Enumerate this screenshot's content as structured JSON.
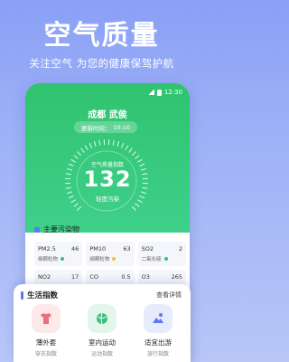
{
  "promo": {
    "title": "空气质量",
    "subtitle": "关注空气 为您的健康保驾护航"
  },
  "status_bar": {
    "time": "12:30"
  },
  "hero": {
    "city": "成都 武侯",
    "update_label": "更新时间：",
    "update_time": "10:10",
    "index_label": "空气质量指数",
    "aqi": "132",
    "level": "轻度污染",
    "colors": {
      "hero": "#2fc36f"
    }
  },
  "pollutants": {
    "title": "主要污染物",
    "items": [
      {
        "name": "PM2.5",
        "value": "46",
        "desc": "细颗粒物",
        "color": "#2fc36f"
      },
      {
        "name": "PM10",
        "value": "63",
        "desc": "细颗粒物",
        "color": "#f2c230"
      },
      {
        "name": "SO2",
        "value": "2",
        "desc": "二氧化硫",
        "color": "#2fc36f"
      },
      {
        "name": "NO2",
        "value": "17",
        "desc": "",
        "color": "#2fc36f"
      },
      {
        "name": "CO",
        "value": "0.5",
        "desc": "",
        "color": "#2fc36f"
      },
      {
        "name": "O3",
        "value": "265",
        "desc": "",
        "color": "#e85a5a"
      }
    ]
  },
  "life": {
    "title": "生活指数",
    "more": "查看详情",
    "items": [
      {
        "name": "薄外套",
        "desc": "穿衣指数",
        "icon": "shirt-icon",
        "bg": "#fde8ea",
        "fg": "#e8707e"
      },
      {
        "name": "室内运动",
        "desc": "运动指数",
        "icon": "sport-icon",
        "bg": "#e4f6ec",
        "fg": "#3cbf78"
      },
      {
        "name": "适宜出游",
        "desc": "旅行指数",
        "icon": "travel-icon",
        "bg": "#e6ebfd",
        "fg": "#5b7cf0"
      }
    ]
  }
}
